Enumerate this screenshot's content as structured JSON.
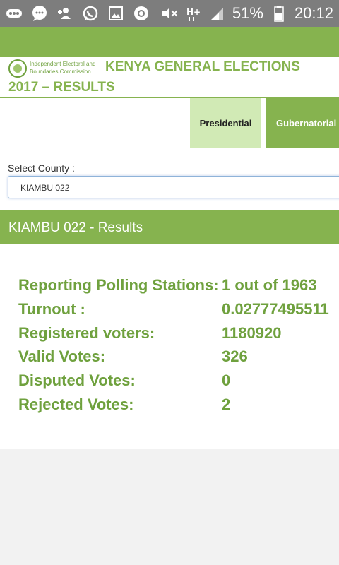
{
  "status_bar": {
    "battery_percent": "51%",
    "time": "20:12",
    "icons_left": [
      "more-icon",
      "message-icon",
      "person-add-icon",
      "whatsapp-icon",
      "gallery-icon",
      "chrome-icon"
    ],
    "icons_right": [
      "mute-icon",
      "hplus-signal-icon",
      "signal-icon",
      "battery-icon"
    ]
  },
  "header": {
    "logo_text": "Independent Electoral and Boundaries Commission",
    "title_line1": "KENYA GENERAL ELECTIONS",
    "title_line2": "2017 – RESULTS"
  },
  "tabs": [
    {
      "label": "Presidential",
      "active": true
    },
    {
      "label": "Gubernatorial",
      "active": false
    }
  ],
  "county_select": {
    "label": "Select County :",
    "value": "KIAMBU 022"
  },
  "results": {
    "title": "KIAMBU 022 - Results",
    "rows": [
      {
        "label": "Reporting Polling Stations:",
        "value": "1 out of 1963"
      },
      {
        "label": "Turnout :",
        "value": "0.02777495511"
      },
      {
        "label": "Registered voters:",
        "value": "1180920"
      },
      {
        "label": "Valid Votes:",
        "value": "326"
      },
      {
        "label": "Disputed Votes:",
        "value": "0"
      },
      {
        "label": "Rejected Votes:",
        "value": "2"
      }
    ]
  },
  "colors": {
    "brand_green": "#86b34f",
    "text_green": "#6fa13e",
    "active_tab": "#d1eab5",
    "status_bar": "#7d7d7d"
  }
}
